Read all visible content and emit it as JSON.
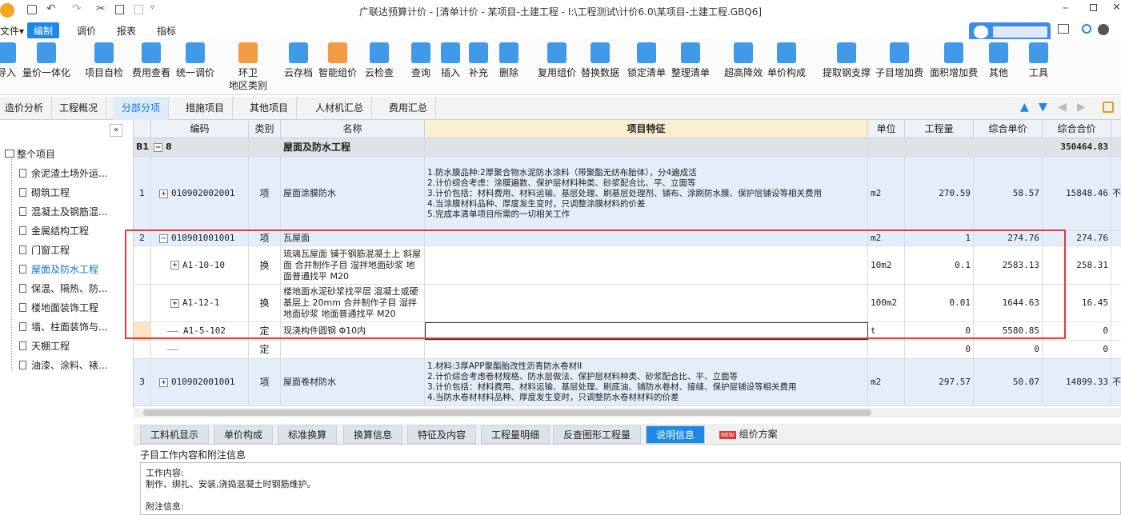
{
  "app": {
    "title": "广联达预算计价 - [清单计价 - 某项目-土建工程 - I:\\工程测试\\计价6.0\\某项目-土建工程.GBQ6]"
  },
  "menu": {
    "items": [
      "文件▾",
      "编制",
      "调价",
      "报表",
      "指标"
    ]
  },
  "ribbon": {
    "items": [
      {
        "label": "导入",
        "icon": "import-icon"
      },
      {
        "label": "量价一体化",
        "icon": "integration-icon"
      },
      {
        "label": "项目自检",
        "icon": "self-check-icon"
      },
      {
        "label": "费用查看",
        "icon": "fee-view-icon"
      },
      {
        "label": "统一调价",
        "icon": "unified-price-icon"
      },
      {
        "label": "环卫\n地区类别",
        "icon": "sanitation-icon"
      },
      {
        "label": "云存档",
        "icon": "cloud-save-icon"
      },
      {
        "label": "智能组价",
        "icon": "smart-price-icon"
      },
      {
        "label": "云检查",
        "icon": "cloud-check-icon"
      },
      {
        "label": "查询",
        "icon": "query-icon"
      },
      {
        "label": "插入",
        "icon": "insert-icon"
      },
      {
        "label": "补充",
        "icon": "supplement-icon"
      },
      {
        "label": "删除",
        "icon": "delete-icon"
      },
      {
        "label": "复用组价",
        "icon": "reuse-icon"
      },
      {
        "label": "替换数据",
        "icon": "replace-icon"
      },
      {
        "label": "锁定清单",
        "icon": "lock-icon"
      },
      {
        "label": "整理清单",
        "icon": "organize-icon"
      },
      {
        "label": "超高降效",
        "icon": "height-icon"
      },
      {
        "label": "单价构成",
        "icon": "unit-price-icon"
      },
      {
        "label": "提取钢支撑",
        "icon": "steel-icon"
      },
      {
        "label": "子目增加费",
        "icon": "sub-fee-icon"
      },
      {
        "label": "面积增加费",
        "icon": "area-fee-icon"
      },
      {
        "label": "其他",
        "icon": "other-icon"
      },
      {
        "label": "工具",
        "icon": "tool-icon"
      }
    ]
  },
  "tabs": [
    "造价分析",
    "工程概况",
    "分部分项",
    "措施项目",
    "其他项目",
    "人材机汇总",
    "费用汇总"
  ],
  "tree": {
    "root": "整个项目",
    "items": [
      "余泥渣土场外运...",
      "砌筑工程",
      "混凝土及钢筋混...",
      "金属结构工程",
      "门窗工程",
      "屋面及防水工程",
      "保温、隔热、防...",
      "楼地面装饰工程",
      "墙、柱面装饰与...",
      "天棚工程",
      "油漆、涂料、裱..."
    ]
  },
  "grid": {
    "headers": [
      "",
      "编码",
      "类别",
      "名称",
      "项目特征",
      "单位",
      "工程量",
      "综合单价",
      "综合合价"
    ],
    "section": {
      "id": "B1",
      "code": "8",
      "name": "屋面及防水工程",
      "total": "350464.83"
    },
    "rows": [
      {
        "idx": "1",
        "tog": "+",
        "code": "010902002001",
        "type": "项",
        "name": "屋面涂膜防水",
        "feature": "1.防水膜品种:2厚聚合物水泥防水涂料（带聚酯无纺布胎体），分4遍成活\n2.计价综合考虑：涂膜遍数、保护层材料种类、砂浆配合比、平、立面等\n3.计价包括：材料费用、材料运输、基层处理、刷基层处理剂、铺布、涂刷防水膜、保护层铺设等相关费用\n4.当涂膜材料品种、厚度发生变时，只调整涂膜材料的价差\n5.完成本清单项目所需的一切相关工作",
        "unit": "m2",
        "qty": "270.59",
        "price": "58.57",
        "total": "15848.46",
        "extra": "不"
      },
      {
        "idx": "2",
        "tog": "−",
        "code": "010901001001",
        "type": "项",
        "name": "瓦屋面",
        "feature": "",
        "unit": "m2",
        "qty": "1",
        "price": "274.76",
        "total": "274.76",
        "extra": ""
      },
      {
        "idx": "",
        "tog": "+",
        "code": "A1-10-10",
        "type": "换",
        "name": "琉璃瓦屋面 铺于钢筋混凝土上 斜屋面  合并制作子目 湿拌地面砂浆 地面普通找平 M20",
        "feature": "",
        "unit": "10m2",
        "qty": "0.1",
        "price": "2583.13",
        "total": "258.31",
        "extra": ""
      },
      {
        "idx": "",
        "tog": "+",
        "code": "A1-12-1",
        "type": "换",
        "name": "楼地面水泥砂浆找平层 混凝土或硬基层上 20mm  合并制作子目 湿拌地面砂浆 地面普通找平 M20",
        "feature": "",
        "unit": "100m2",
        "qty": "0.01",
        "price": "1644.63",
        "total": "16.45",
        "extra": ""
      },
      {
        "idx": "",
        "tog": "",
        "code": "A1-5-102",
        "type": "定",
        "name": "现浇构件圆钢 Φ10内",
        "feature": "",
        "unit": "t",
        "qty": "0",
        "price": "5580.85",
        "total": "0",
        "extra": ""
      },
      {
        "idx": "",
        "tog": "",
        "code": "",
        "type": "定",
        "name": "",
        "feature": "",
        "unit": "",
        "qty": "0",
        "price": "0",
        "total": "0",
        "extra": ""
      },
      {
        "idx": "3",
        "tog": "+",
        "code": "010902001001",
        "type": "项",
        "name": "屋面卷材防水",
        "feature": "1.材料:3厚APP聚酯胎改性沥青防水卷材II\n2.计价综合考虑卷材规格、防水层做法、保护层材料种类、砂浆配合比、平、立面等\n3.计价包括：材料费用、材料运输、基层处理、刷底油、铺防水卷材、接缝、保护层铺设等相关费用\n4.当防水卷材材料品种、厚度发生变时，只调整防水卷材材料的价差",
        "unit": "m2",
        "qty": "297.57",
        "price": "50.07",
        "total": "14899.33",
        "extra": "不"
      }
    ]
  },
  "bottom_tabs": [
    "工料机显示",
    "单价构成",
    "标准换算",
    "换算信息",
    "特征及内容",
    "工程量明细",
    "反查图形工程量",
    "说明信息",
    "组价方案"
  ],
  "new_badge": "NEW",
  "info": {
    "title": "子目工作内容和附注信息",
    "work_label": "工作内容:",
    "work_text": "制作、绑扎、安装,浇捣混凝土时钢筋维护。",
    "note_label": "附注信息:"
  },
  "colors": {
    "accent": "#1e88e5",
    "highlight_border": "#e53935",
    "header_bg": "#eef2f7",
    "row_blue": "#e4eefa"
  }
}
